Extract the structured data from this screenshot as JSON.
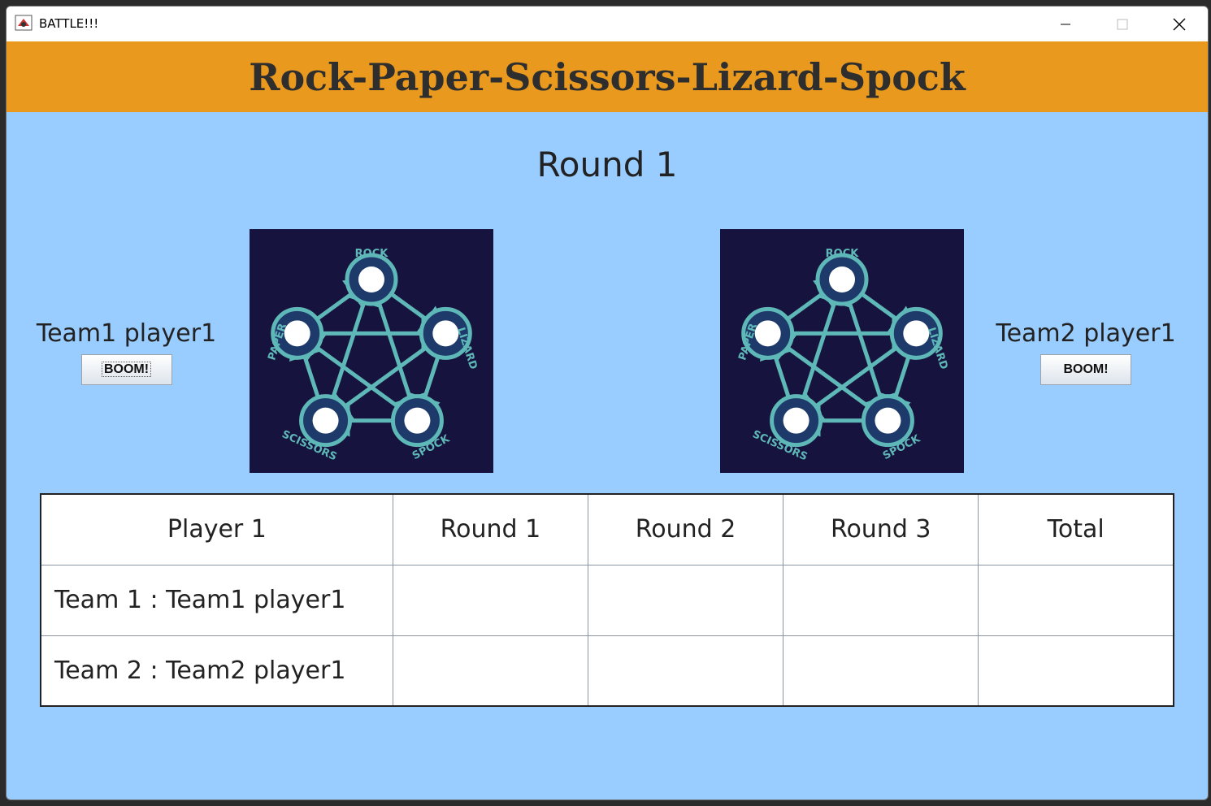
{
  "window": {
    "title": "BATTLE!!!"
  },
  "banner": {
    "title": "Rock-Paper-Scissors-Lizard-Spock"
  },
  "round_label": "Round 1",
  "players": {
    "left": {
      "name": "Team1 player1",
      "button": "BOOM!"
    },
    "right": {
      "name": "Team2 player1",
      "button": "BOOM!"
    }
  },
  "diagram": {
    "labels": [
      "ROCK",
      "LIZARD",
      "SPOCK",
      "SCISSORS",
      "PAPER"
    ]
  },
  "table": {
    "headers": [
      "Player 1",
      "Round 1",
      "Round 2",
      "Round 3",
      "Total"
    ],
    "rows": [
      {
        "name": "Team 1 : Team1 player1",
        "r1": "",
        "r2": "",
        "r3": "",
        "total": ""
      },
      {
        "name": "Team 2 : Team2 player1",
        "r1": "",
        "r2": "",
        "r3": "",
        "total": ""
      }
    ]
  },
  "colors": {
    "background": "#99ccff",
    "banner": "#ea991f",
    "image_bg": "#16143e",
    "diagram_accent": "#5fb8b8"
  }
}
